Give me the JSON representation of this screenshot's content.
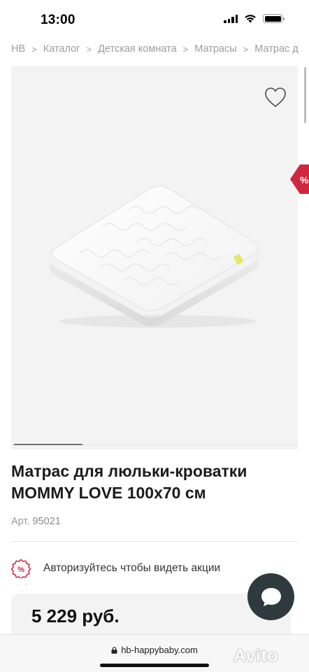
{
  "status_bar": {
    "time": "13:00"
  },
  "breadcrumb": [
    "HB",
    "Каталог",
    "Детская комната",
    "Матрасы",
    "Матрас д"
  ],
  "product": {
    "title_line1": "Матрас для люльки-кроватки",
    "title_line2": "MOMMY LOVE 100x70 см",
    "sku_label": "Арт.",
    "sku_value": "95021"
  },
  "promo": {
    "badge": "%",
    "text": "Авторизуйтесь чтобы видеть акции"
  },
  "price": {
    "value": "5 229 руб."
  },
  "browser": {
    "url": "hb-happybaby.com"
  },
  "watermark": {
    "text": "Avito"
  },
  "colors": {
    "accent": "#d1263f",
    "chat_button": "#2f3a3e",
    "gallery_bg": "#f3f3f3"
  },
  "icons": [
    "heart-icon",
    "percent-tab-icon",
    "chat-icon",
    "lock-icon",
    "wifi-icon",
    "signal-icon",
    "battery-icon"
  ]
}
